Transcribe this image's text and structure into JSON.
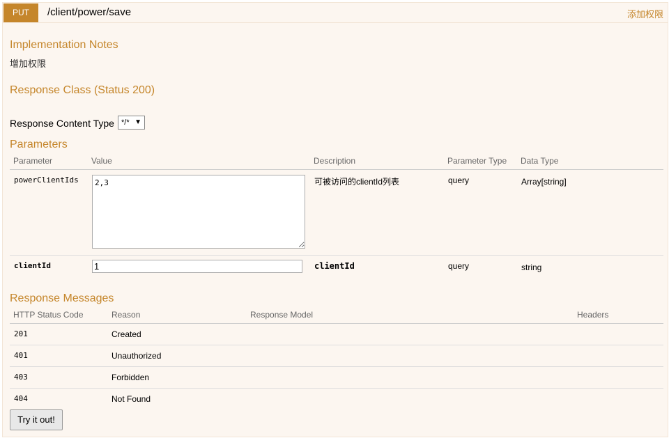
{
  "operation": {
    "method": "PUT",
    "path": "/client/power/save",
    "summary": "添加权限"
  },
  "implementation_notes": {
    "heading": "Implementation Notes",
    "text": "增加权限"
  },
  "response_class": {
    "heading": "Response Class (Status 200)"
  },
  "response_content_type": {
    "label": "Response Content Type",
    "selected": "*/*"
  },
  "parameters": {
    "heading": "Parameters",
    "columns": [
      "Parameter",
      "Value",
      "Description",
      "Parameter Type",
      "Data Type"
    ],
    "rows": [
      {
        "name": "powerClientIds",
        "value": "2,3",
        "description": "可被访问的clientId列表",
        "param_type": "query",
        "data_type": "Array[string]"
      },
      {
        "name": "clientId",
        "value": "1",
        "description": "clientId",
        "param_type": "query",
        "data_type": "string"
      }
    ]
  },
  "response_messages": {
    "heading": "Response Messages",
    "columns": [
      "HTTP Status Code",
      "Reason",
      "Response Model",
      "Headers"
    ],
    "rows": [
      {
        "code": "201",
        "reason": "Created"
      },
      {
        "code": "401",
        "reason": "Unauthorized"
      },
      {
        "code": "403",
        "reason": "Forbidden"
      },
      {
        "code": "404",
        "reason": "Not Found"
      }
    ]
  },
  "try_button": "Try it out!",
  "colors": {
    "accent": "#c5862b",
    "panel_bg": "#fcf6f0"
  }
}
